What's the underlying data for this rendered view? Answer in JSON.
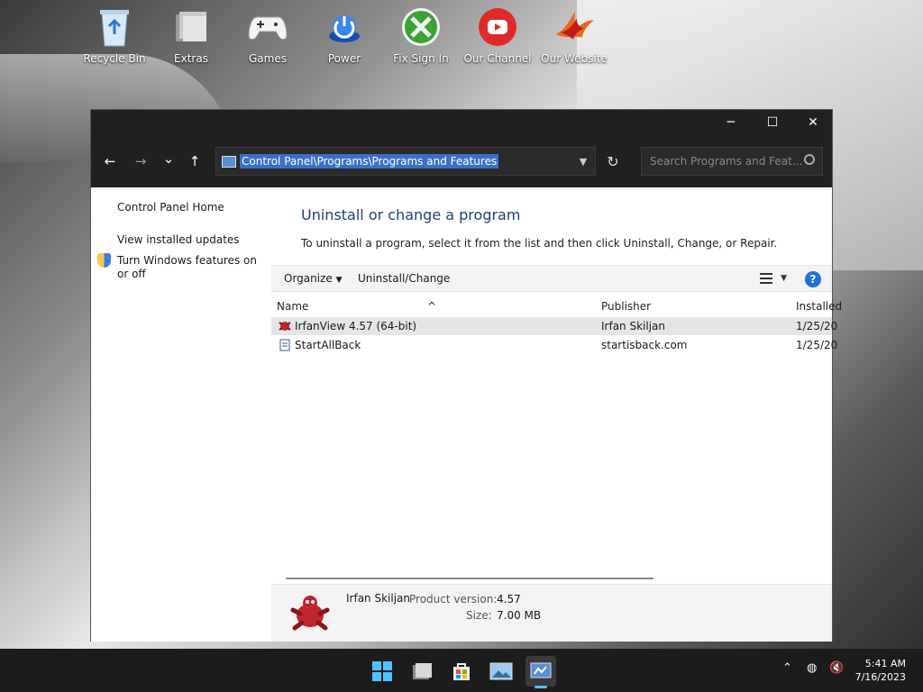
{
  "desktop": {
    "icons": [
      {
        "label": "Recycle Bin",
        "icon": "recycle-bin-icon"
      },
      {
        "label": "Extras",
        "icon": "folder-icon"
      },
      {
        "label": "Games",
        "icon": "gamepad-icon"
      },
      {
        "label": "Power",
        "icon": "power-icon"
      },
      {
        "label": "Fix Sign In",
        "icon": "xbox-icon"
      },
      {
        "label": "Our Channel",
        "icon": "youtube-icon"
      },
      {
        "label": "Our Website",
        "icon": "phoenix-logo-icon"
      }
    ]
  },
  "window": {
    "controls": {
      "minimize": "─",
      "maximize": "☐",
      "close": "✕"
    },
    "nav": {
      "back": "←",
      "forward": "→",
      "recent": "⌄",
      "up": "↑"
    },
    "address_path": "Control Panel\\Programs\\Programs and Features",
    "search_placeholder": "Search Programs and Feat...",
    "left_pane": {
      "home": "Control Panel Home",
      "updates": "View installed updates",
      "features": "Turn Windows features on or off"
    },
    "main": {
      "title": "Uninstall or change a program",
      "description": "To uninstall a program, select it from the list and then click Uninstall, Change, or Repair.",
      "toolbar": {
        "organize": "Organize",
        "uninstall_change": "Uninstall/Change",
        "help": "?"
      },
      "columns": {
        "name": "Name",
        "publisher": "Publisher",
        "installed": "Installed"
      },
      "programs": [
        {
          "name": "IrfanView 4.57 (64-bit)",
          "publisher": "Irfan Skiljan",
          "installed": "1/25/20",
          "selected": true
        },
        {
          "name": "StartAllBack",
          "publisher": "startisback.com",
          "installed": "1/25/20",
          "selected": false
        }
      ],
      "details": {
        "publisher": "Irfan Skiljan",
        "version_label": "Product version:",
        "version": "4.57",
        "size_label": "Size:",
        "size": "7.00 MB"
      }
    }
  },
  "taskbar": {
    "apps": [
      "start-icon",
      "file-explorer-icon",
      "store-icon",
      "photos-icon",
      "control-panel-icon"
    ],
    "clock_time": "5:41 AM",
    "clock_date": "7/16/2023"
  },
  "colors": {
    "accent": "#1f3f7a",
    "selection": "#3a70c9",
    "titlebar": "#202020",
    "taskbar": "#1c1c1c"
  }
}
